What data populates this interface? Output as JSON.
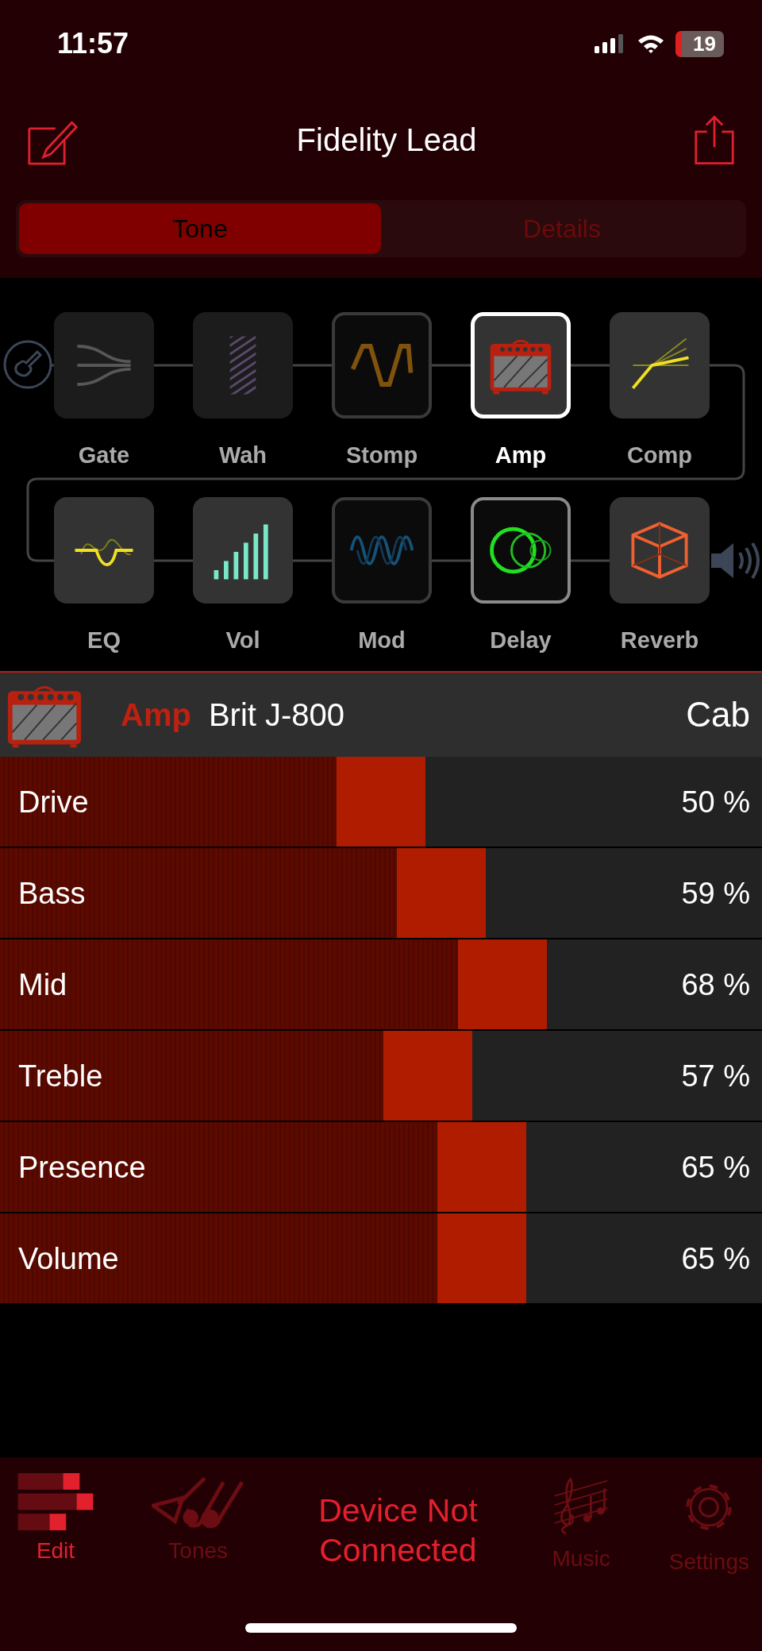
{
  "status_bar": {
    "time": "11:57",
    "battery": "19"
  },
  "nav": {
    "title": "Fidelity Lead"
  },
  "segments": [
    {
      "label": "Tone",
      "selected": true
    },
    {
      "label": "Details",
      "selected": false
    }
  ],
  "chain": [
    {
      "label": "Gate",
      "kind": "gate",
      "enabled": false,
      "bypassed": false,
      "focused": false,
      "selected": false
    },
    {
      "label": "Wah",
      "kind": "wah",
      "enabled": false,
      "bypassed": false,
      "focused": false,
      "selected": false
    },
    {
      "label": "Stomp",
      "kind": "stomp",
      "enabled": true,
      "bypassed": true,
      "focused": false,
      "selected": false
    },
    {
      "label": "Amp",
      "kind": "amp",
      "enabled": true,
      "bypassed": false,
      "focused": false,
      "selected": true
    },
    {
      "label": "Comp",
      "kind": "comp",
      "enabled": true,
      "bypassed": false,
      "focused": false,
      "selected": false
    },
    {
      "label": "EQ",
      "kind": "eq",
      "enabled": true,
      "bypassed": false,
      "focused": false,
      "selected": false
    },
    {
      "label": "Vol",
      "kind": "vol",
      "enabled": true,
      "bypassed": false,
      "focused": false,
      "selected": false
    },
    {
      "label": "Mod",
      "kind": "mod",
      "enabled": true,
      "bypassed": true,
      "focused": false,
      "selected": false
    },
    {
      "label": "Delay",
      "kind": "delay",
      "enabled": true,
      "bypassed": false,
      "focused": true,
      "selected": false
    },
    {
      "label": "Reverb",
      "kind": "reverb",
      "enabled": true,
      "bypassed": false,
      "focused": false,
      "selected": false
    }
  ],
  "model": {
    "category": "Amp",
    "name": "Brit J-800",
    "cab": "Cab"
  },
  "params": [
    {
      "name": "Drive",
      "level": 0.5,
      "reading": "50 %"
    },
    {
      "name": "Bass",
      "level": 0.59,
      "reading": "59 %"
    },
    {
      "name": "Mid",
      "level": 0.68,
      "reading": "68 %"
    },
    {
      "name": "Treble",
      "level": 0.57,
      "reading": "57 %"
    },
    {
      "name": "Presence",
      "level": 0.65,
      "reading": "65 %"
    },
    {
      "name": "Volume",
      "level": 0.65,
      "reading": "65 %"
    }
  ],
  "tab_bar": {
    "items": [
      {
        "label": "Edit",
        "kind": "edit",
        "selected": true
      },
      {
        "label": "Tones",
        "kind": "tones",
        "selected": false
      },
      {
        "label": "Music",
        "kind": "music",
        "selected": false
      },
      {
        "label": "Settings",
        "kind": "settings",
        "selected": false
      }
    ],
    "notice": "Device Not Connected"
  }
}
